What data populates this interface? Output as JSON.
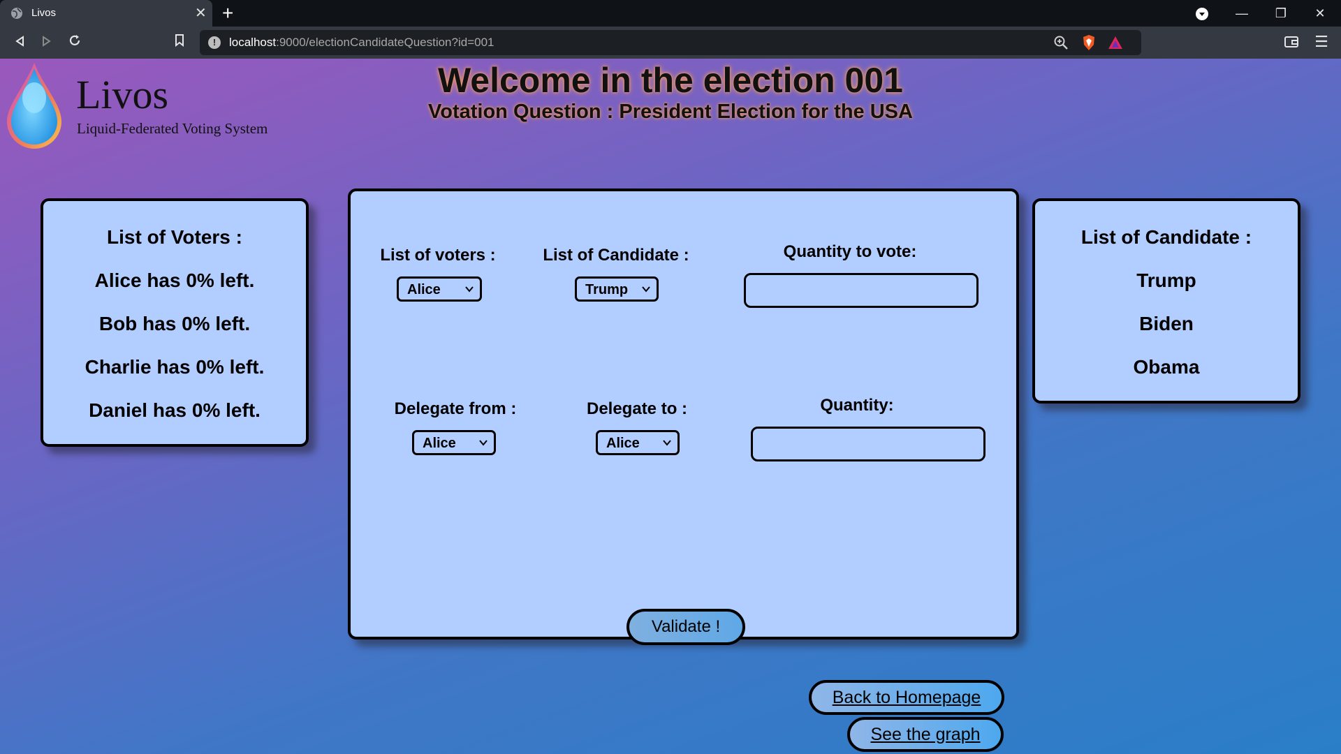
{
  "browser": {
    "tab_title": "Livos",
    "url_host": "localhost",
    "url_path": ":9000/electionCandidateQuestion?id=001"
  },
  "logo": {
    "name": "Livos",
    "subtitle": "Liquid-Federated Voting System"
  },
  "header": {
    "title": "Welcome in the election 001",
    "subtitle": "Votation Question : President Election for the USA"
  },
  "voters_panel": {
    "title": "List of Voters :",
    "items": [
      "Alice has 0% left.",
      "Bob has 0% left.",
      "Charlie has 0% left.",
      "Daniel has 0% left."
    ]
  },
  "candidates_panel": {
    "title": "List of Candidate :",
    "items": [
      "Trump",
      "Biden",
      "Obama"
    ]
  },
  "vote_form": {
    "voters_label": "List of voters :",
    "voters_selected": "Alice",
    "candidate_label": "List of Candidate :",
    "candidate_selected": "Trump",
    "quantity_label": "Quantity to vote:",
    "quantity_value": ""
  },
  "delegate_form": {
    "from_label": "Delegate from :",
    "from_selected": "Alice",
    "to_label": "Delegate to :",
    "to_selected": "Alice",
    "quantity_label": "Quantity:",
    "quantity_value": ""
  },
  "actions": {
    "validate": "Validate !",
    "back_home": "Back to Homepage",
    "see_graph": "See the graph"
  },
  "colors": {
    "panel_bg": "#b2cdff",
    "gradient_start": "#9a58bc",
    "gradient_end": "#2a7ec8"
  }
}
